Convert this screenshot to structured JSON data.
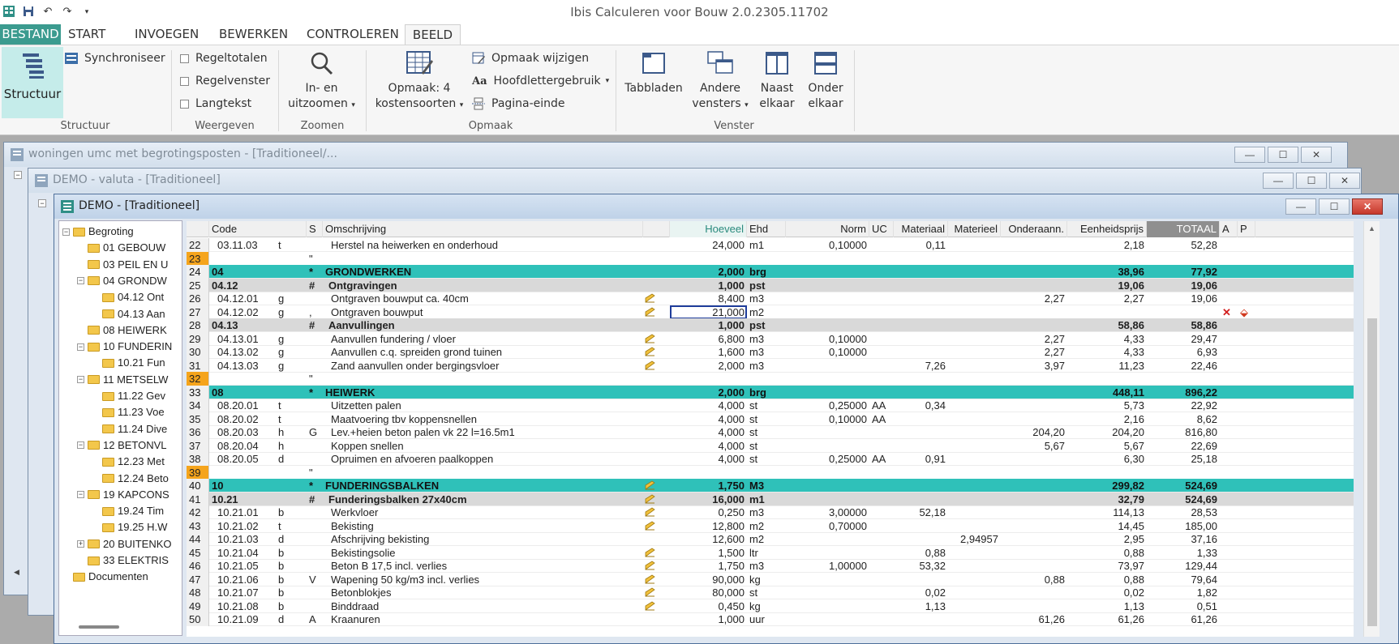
{
  "app": {
    "title": "Ibis Calculeren voor Bouw 2.0.2305.11702"
  },
  "tabs": [
    "BESTAND",
    "START",
    "INVOEGEN",
    "BEWERKEN",
    "CONTROLEREN",
    "BEELD"
  ],
  "ribbon": {
    "structuur": {
      "button": "Structuur",
      "sync": "Synchroniseer",
      "group": "Structuur"
    },
    "weergeven": {
      "items": [
        "Regeltotalen",
        "Regelvenster",
        "Langtekst"
      ],
      "group": "Weergeven"
    },
    "zoomen": {
      "line1": "In- en",
      "line2": "uitzoomen",
      "group": "Zoomen"
    },
    "opmaak": {
      "line1": "Opmaak: 4",
      "line2": "kostensoorten",
      "wijzigen": "Opmaak wijzigen",
      "hoofdletter": "Hoofdlettergebruik",
      "pagina": "Pagina-einde",
      "group": "Opmaak"
    },
    "venster": {
      "tabbladen": "Tabbladen",
      "andere1": "Andere",
      "andere2": "vensters",
      "naast1": "Naast",
      "naast2": "elkaar",
      "onder1": "Onder",
      "onder2": "elkaar",
      "group": "Venster"
    }
  },
  "windows": {
    "w1": "woningen umc met begrotingsposten - [Traditioneel/...",
    "w2": "DEMO - valuta - [Traditioneel]",
    "w3": "DEMO - [Traditioneel]"
  },
  "tree": [
    {
      "label": "Begroting",
      "level": 0,
      "exp": "−"
    },
    {
      "label": "01 GEBOUW",
      "level": 1,
      "exp": ""
    },
    {
      "label": "03 PEIL EN U",
      "level": 1,
      "exp": ""
    },
    {
      "label": "04 GRONDW",
      "level": 1,
      "exp": "−"
    },
    {
      "label": "04.12 Ont",
      "level": 2,
      "exp": ""
    },
    {
      "label": "04.13 Aan",
      "level": 2,
      "exp": ""
    },
    {
      "label": "08 HEIWERK",
      "level": 1,
      "exp": ""
    },
    {
      "label": "10 FUNDERIN",
      "level": 1,
      "exp": "−"
    },
    {
      "label": "10.21 Fun",
      "level": 2,
      "exp": ""
    },
    {
      "label": "11 METSELW",
      "level": 1,
      "exp": "−"
    },
    {
      "label": "11.22 Gev",
      "level": 2,
      "exp": ""
    },
    {
      "label": "11.23 Voe",
      "level": 2,
      "exp": ""
    },
    {
      "label": "11.24 Dive",
      "level": 2,
      "exp": ""
    },
    {
      "label": "12 BETONVL",
      "level": 1,
      "exp": "−"
    },
    {
      "label": "12.23 Met",
      "level": 2,
      "exp": ""
    },
    {
      "label": "12.24 Beto",
      "level": 2,
      "exp": ""
    },
    {
      "label": "19 KAPCONS",
      "level": 1,
      "exp": "−"
    },
    {
      "label": "19.24 Tim",
      "level": 2,
      "exp": ""
    },
    {
      "label": "19.25 H.W",
      "level": 2,
      "exp": ""
    },
    {
      "label": "20 BUITENKO",
      "level": 1,
      "exp": "+"
    },
    {
      "label": "33 ELEKTRIS",
      "level": 1,
      "exp": ""
    },
    {
      "label": "Documenten",
      "level": 0,
      "exp": ""
    }
  ],
  "grid": {
    "headers": [
      "",
      "Code",
      "S",
      "Omschrijving",
      "",
      "Hoeveel",
      "Ehd",
      "Norm",
      "UC",
      "Materiaal",
      "Materieel",
      "Onderaann.",
      "Eenheidsprijs",
      "TOTAAL",
      "A",
      "P"
    ],
    "rows": [
      {
        "n": "22",
        "code": "03.11.03",
        "t": "t",
        "s": "",
        "desc": "Herstel na heiwerken en onderhoud",
        "p": false,
        "q": "24,000",
        "ehd": "m1",
        "norm": "0,10000",
        "uc": "",
        "mat": "0,11",
        "mtl": "",
        "ond": "",
        "eh": "2,18",
        "tot": "52,28",
        "kind": "normal"
      },
      {
        "n": "23",
        "code": "",
        "t": "",
        "s": "\"",
        "desc": "",
        "p": false,
        "q": "",
        "ehd": "",
        "norm": "",
        "uc": "",
        "mat": "",
        "mtl": "",
        "ond": "",
        "eh": "",
        "tot": "",
        "kind": "empty"
      },
      {
        "n": "24",
        "code": "04",
        "t": "",
        "s": "*",
        "desc": "GRONDWERKEN",
        "p": false,
        "q": "2,000",
        "ehd": "brg",
        "norm": "",
        "uc": "",
        "mat": "",
        "mtl": "",
        "ond": "",
        "eh": "38,96",
        "tot": "77,92",
        "kind": "teal"
      },
      {
        "n": "25",
        "code": "04.12",
        "t": "",
        "s": "#",
        "desc": "Ontgravingen",
        "p": false,
        "q": "1,000",
        "ehd": "pst",
        "norm": "",
        "uc": "",
        "mat": "",
        "mtl": "",
        "ond": "",
        "eh": "19,06",
        "tot": "19,06",
        "kind": "sub"
      },
      {
        "n": "26",
        "code": "04.12.01",
        "t": "g",
        "s": "",
        "desc": "Ontgraven bouwput ca. 40cm",
        "p": true,
        "q": "8,400",
        "ehd": "m3",
        "norm": "",
        "uc": "",
        "mat": "",
        "mtl": "",
        "ond": "2,27",
        "eh": "2,27",
        "tot": "19,06",
        "kind": "normal"
      },
      {
        "n": "27",
        "code": "04.12.02",
        "t": "g",
        "s": ",",
        "desc": "Ontgraven bouwput",
        "p": true,
        "q": "21,000",
        "ehd": "m2",
        "norm": "",
        "uc": "",
        "mat": "",
        "mtl": "",
        "ond": "",
        "eh": "",
        "tot": "",
        "kind": "selected"
      },
      {
        "n": "28",
        "code": "04.13",
        "t": "",
        "s": "#",
        "desc": "Aanvullingen",
        "p": false,
        "q": "1,000",
        "ehd": "pst",
        "norm": "",
        "uc": "",
        "mat": "",
        "mtl": "",
        "ond": "",
        "eh": "58,86",
        "tot": "58,86",
        "kind": "sub"
      },
      {
        "n": "29",
        "code": "04.13.01",
        "t": "g",
        "s": "",
        "desc": "Aanvullen fundering / vloer",
        "p": true,
        "q": "6,800",
        "ehd": "m3",
        "norm": "0,10000",
        "uc": "",
        "mat": "",
        "mtl": "",
        "ond": "2,27",
        "eh": "4,33",
        "tot": "29,47",
        "kind": "normal"
      },
      {
        "n": "30",
        "code": "04.13.02",
        "t": "g",
        "s": "",
        "desc": "Aanvullen c.q. spreiden grond tuinen",
        "p": true,
        "q": "1,600",
        "ehd": "m3",
        "norm": "0,10000",
        "uc": "",
        "mat": "",
        "mtl": "",
        "ond": "2,27",
        "eh": "4,33",
        "tot": "6,93",
        "kind": "normal"
      },
      {
        "n": "31",
        "code": "04.13.03",
        "t": "g",
        "s": "",
        "desc": "Zand aanvullen onder bergingsvloer",
        "p": true,
        "q": "2,000",
        "ehd": "m3",
        "norm": "",
        "uc": "",
        "mat": "7,26",
        "mtl": "",
        "ond": "3,97",
        "eh": "11,23",
        "tot": "22,46",
        "kind": "normal"
      },
      {
        "n": "32",
        "code": "",
        "t": "",
        "s": "\"",
        "desc": "",
        "p": false,
        "q": "",
        "ehd": "",
        "norm": "",
        "uc": "",
        "mat": "",
        "mtl": "",
        "ond": "",
        "eh": "",
        "tot": "",
        "kind": "empty"
      },
      {
        "n": "33",
        "code": "08",
        "t": "",
        "s": "*",
        "desc": "HEIWERK",
        "p": false,
        "q": "2,000",
        "ehd": "brg",
        "norm": "",
        "uc": "",
        "mat": "",
        "mtl": "",
        "ond": "",
        "eh": "448,11",
        "tot": "896,22",
        "kind": "teal"
      },
      {
        "n": "34",
        "code": "08.20.01",
        "t": "t",
        "s": "",
        "desc": "Uitzetten palen",
        "p": false,
        "q": "4,000",
        "ehd": "st",
        "norm": "0,25000",
        "uc": "AA",
        "mat": "0,34",
        "mtl": "",
        "ond": "",
        "eh": "5,73",
        "tot": "22,92",
        "kind": "normal"
      },
      {
        "n": "35",
        "code": "08.20.02",
        "t": "t",
        "s": "",
        "desc": "Maatvoering tbv koppensnellen",
        "p": false,
        "q": "4,000",
        "ehd": "st",
        "norm": "0,10000",
        "uc": "AA",
        "mat": "",
        "mtl": "",
        "ond": "",
        "eh": "2,16",
        "tot": "8,62",
        "kind": "normal"
      },
      {
        "n": "36",
        "code": "08.20.03",
        "t": "h",
        "s": "G",
        "desc": "Lev.+heien beton palen vk 22 l=16.5m1",
        "p": false,
        "q": "4,000",
        "ehd": "st",
        "norm": "",
        "uc": "",
        "mat": "",
        "mtl": "",
        "ond": "204,20",
        "eh": "204,20",
        "tot": "816,80",
        "kind": "normal"
      },
      {
        "n": "37",
        "code": "08.20.04",
        "t": "h",
        "s": "",
        "desc": "Koppen snellen",
        "p": false,
        "q": "4,000",
        "ehd": "st",
        "norm": "",
        "uc": "",
        "mat": "",
        "mtl": "",
        "ond": "5,67",
        "eh": "5,67",
        "tot": "22,69",
        "kind": "normal"
      },
      {
        "n": "38",
        "code": "08.20.05",
        "t": "d",
        "s": "",
        "desc": "Opruimen en afvoeren paalkoppen",
        "p": false,
        "q": "4,000",
        "ehd": "st",
        "norm": "0,25000",
        "uc": "AA",
        "mat": "0,91",
        "mtl": "",
        "ond": "",
        "eh": "6,30",
        "tot": "25,18",
        "kind": "normal"
      },
      {
        "n": "39",
        "code": "",
        "t": "",
        "s": "\"",
        "desc": "",
        "p": false,
        "q": "",
        "ehd": "",
        "norm": "",
        "uc": "",
        "mat": "",
        "mtl": "",
        "ond": "",
        "eh": "",
        "tot": "",
        "kind": "empty"
      },
      {
        "n": "40",
        "code": "10",
        "t": "",
        "s": "*",
        "desc": "FUNDERINGSBALKEN",
        "p": true,
        "q": "1,750",
        "ehd": "M3",
        "norm": "",
        "uc": "",
        "mat": "",
        "mtl": "",
        "ond": "",
        "eh": "299,82",
        "tot": "524,69",
        "kind": "teal"
      },
      {
        "n": "41",
        "code": "10.21",
        "t": "",
        "s": "#",
        "desc": "Funderingsbalken 27x40cm",
        "p": true,
        "q": "16,000",
        "ehd": "m1",
        "norm": "",
        "uc": "",
        "mat": "",
        "mtl": "",
        "ond": "",
        "eh": "32,79",
        "tot": "524,69",
        "kind": "sub"
      },
      {
        "n": "42",
        "code": "10.21.01",
        "t": "b",
        "s": "",
        "desc": "Werkvloer",
        "p": true,
        "q": "0,250",
        "ehd": "m3",
        "norm": "3,00000",
        "uc": "",
        "mat": "52,18",
        "mtl": "",
        "ond": "",
        "eh": "114,13",
        "tot": "28,53",
        "kind": "normal"
      },
      {
        "n": "43",
        "code": "10.21.02",
        "t": "t",
        "s": "",
        "desc": "Bekisting",
        "p": true,
        "q": "12,800",
        "ehd": "m2",
        "norm": "0,70000",
        "uc": "",
        "mat": "",
        "mtl": "",
        "ond": "",
        "eh": "14,45",
        "tot": "185,00",
        "kind": "normal"
      },
      {
        "n": "44",
        "code": "10.21.03",
        "t": "d",
        "s": "",
        "desc": "Afschrijving bekisting",
        "p": false,
        "q": "12,600",
        "ehd": "m2",
        "norm": "",
        "uc": "",
        "mat": "",
        "mtl": "2,94957",
        "ond": "",
        "eh": "2,95",
        "tot": "37,16",
        "kind": "normal"
      },
      {
        "n": "45",
        "code": "10.21.04",
        "t": "b",
        "s": "",
        "desc": "Bekistingsolie",
        "p": true,
        "q": "1,500",
        "ehd": "ltr",
        "norm": "",
        "uc": "",
        "mat": "0,88",
        "mtl": "",
        "ond": "",
        "eh": "0,88",
        "tot": "1,33",
        "kind": "normal"
      },
      {
        "n": "46",
        "code": "10.21.05",
        "t": "b",
        "s": "",
        "desc": "Beton B 17,5        incl. verlies",
        "p": true,
        "q": "1,750",
        "ehd": "m3",
        "norm": "1,00000",
        "uc": "",
        "mat": "53,32",
        "mtl": "",
        "ond": "",
        "eh": "73,97",
        "tot": "129,44",
        "kind": "normal"
      },
      {
        "n": "47",
        "code": "10.21.06",
        "t": "b",
        "s": "V",
        "desc": "Wapening 50 kg/m3 incl. verlies",
        "p": true,
        "q": "90,000",
        "ehd": "kg",
        "norm": "",
        "uc": "",
        "mat": "",
        "mtl": "",
        "ond": "0,88",
        "eh": "0,88",
        "tot": "79,64",
        "kind": "normal"
      },
      {
        "n": "48",
        "code": "10.21.07",
        "t": "b",
        "s": "",
        "desc": "Betonblokjes",
        "p": true,
        "q": "80,000",
        "ehd": "st",
        "norm": "",
        "uc": "",
        "mat": "0,02",
        "mtl": "",
        "ond": "",
        "eh": "0,02",
        "tot": "1,82",
        "kind": "normal"
      },
      {
        "n": "49",
        "code": "10.21.08",
        "t": "b",
        "s": "",
        "desc": "Binddraad",
        "p": true,
        "q": "0,450",
        "ehd": "kg",
        "norm": "",
        "uc": "",
        "mat": "1,13",
        "mtl": "",
        "ond": "",
        "eh": "1,13",
        "tot": "0,51",
        "kind": "normal"
      },
      {
        "n": "50",
        "code": "10.21.09",
        "t": "d",
        "s": "A",
        "desc": "Kraanuren",
        "p": false,
        "q": "1,000",
        "ehd": "uur",
        "norm": "",
        "uc": "",
        "mat": "",
        "mtl": "",
        "ond": "61,26",
        "eh": "61,26",
        "tot": "61,26",
        "kind": "normal"
      }
    ]
  },
  "colors": {
    "accent": "#3b9b8f",
    "teal_row": "#2fc1b9",
    "sub_row": "#d9d9d9",
    "empty_rownum": "#f5a41c"
  }
}
